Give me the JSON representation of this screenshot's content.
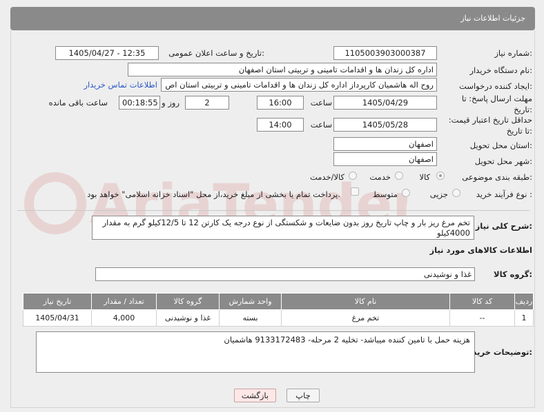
{
  "header": {
    "title": "جزئیات اطلاعات نیاز"
  },
  "labels": {
    "need_number": "شماره نیاز:",
    "announce_datetime": "تاریخ و ساعت اعلان عمومی:",
    "buyer_org": "نام دستگاه خریدار:",
    "requester": "ایجاد کننده درخواست:",
    "reply_deadline": "مهلت ارسال پاسخ: تا تاریخ:",
    "price_validity": "حداقل تاریخ اعتبار قیمت: تا تاریخ:",
    "delivery_province": "استان محل تحویل:",
    "delivery_city": "شهر محل تحویل:",
    "subject_category": "طبقه بندی موضوعی:",
    "purchase_process": "نوع فرآیند خرید :",
    "hour": "ساعت",
    "day_and": "روز و",
    "time_remaining": "ساعت باقی مانده",
    "general_description": "شرح کلی نیاز:",
    "goods_info": "اطلاعات کالاهای مورد نیاز",
    "goods_group": "گروه کالا:",
    "buyer_notes": "توضیحات خریدار:"
  },
  "fields": {
    "need_number": "1105003903000387",
    "announce_datetime": "1405/04/27 - 12:35",
    "buyer_org": "اداره کل زندان ها و اقدامات تامینی و تربیتی استان اصفهان",
    "requester": "روح اله هاشمیان کارپرداز اداره کل زندان ها و اقدامات تامینی و تربیتی استان اص",
    "buyer_contact_link": "اطلاعات تماس خریدار",
    "reply_date": "1405/04/29",
    "reply_time": "16:00",
    "reply_days": "2",
    "reply_remaining": "00:18:55",
    "price_date": "1405/05/28",
    "price_time": "14:00",
    "delivery_province": "اصفهان",
    "delivery_city": "اصفهان",
    "general_description": "تخم مرغ ریز بار و چاپ تاریخ روز بدون ضایعات و شکستگی از نوع درجه یک کارتن 12 تا 12/5کیلو گرم به مقدار 4000کیلو",
    "goods_group": "غذا و نوشیدنی",
    "buyer_notes": "هزینه حمل با تامین کننده میباشد- تخلیه 2 مرحله- 9133172483 هاشمیان"
  },
  "subject_options": [
    {
      "label": "کالا",
      "selected": true
    },
    {
      "label": "خدمت",
      "selected": false
    },
    {
      "label": "کالا/خدمت",
      "selected": false
    }
  ],
  "process_options": [
    {
      "label": "جزیی",
      "selected": false
    },
    {
      "label": "متوسط",
      "selected": false
    }
  ],
  "payment_note": "پرداخت تمام یا بخشی از مبلغ خرید،از محل \"اسناد خزانه اسلامی\" خواهد بود.",
  "table": {
    "headers": [
      "ردیف",
      "کد کالا",
      "نام کالا",
      "واحد شمارش",
      "گروه کالا",
      "تعداد / مقدار",
      "تاریخ نیاز"
    ],
    "rows": [
      [
        "1",
        "--",
        "تخم مرغ",
        "بسته",
        "غذا و نوشیدنی",
        "4,000",
        "1405/04/31"
      ]
    ]
  },
  "buttons": {
    "print": "چاپ",
    "back": "بازگشت"
  },
  "watermark": "AriaTender.net"
}
